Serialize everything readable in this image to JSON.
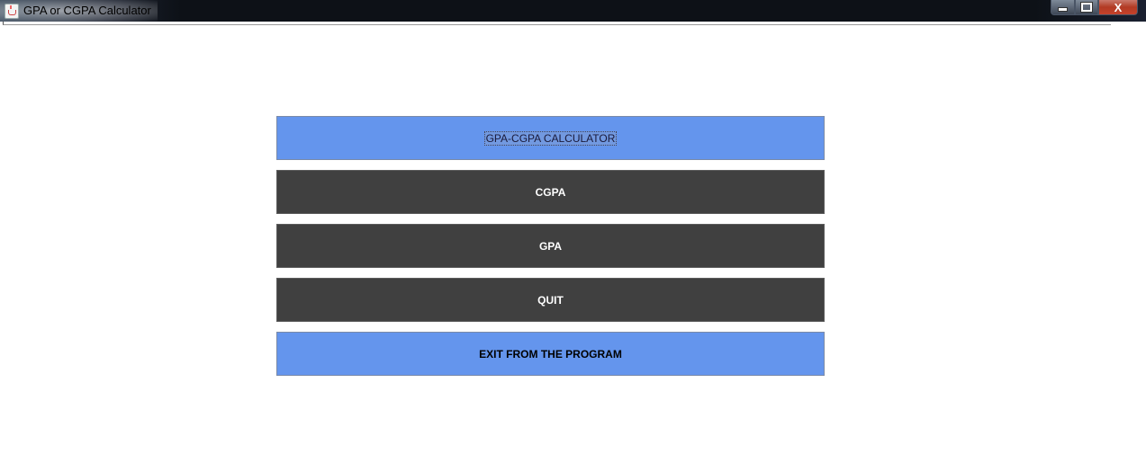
{
  "window": {
    "title": "GPA or CGPA Calculator",
    "icon": "java-cup-icon",
    "controls": {
      "minimize_icon": "minimize-icon",
      "maximize_icon": "maximize-icon",
      "close_glyph": "X"
    }
  },
  "main": {
    "header_label": "GPA-CGPA CALCULATOR",
    "buttons": [
      {
        "label": "CGPA"
      },
      {
        "label": "GPA"
      },
      {
        "label": "QUIT"
      }
    ],
    "exit_label": "EXIT FROM THE PROGRAM"
  },
  "colors": {
    "accent_blue": "#6495ED",
    "dark_button": "#404040",
    "title_bar": "#0D1117"
  }
}
